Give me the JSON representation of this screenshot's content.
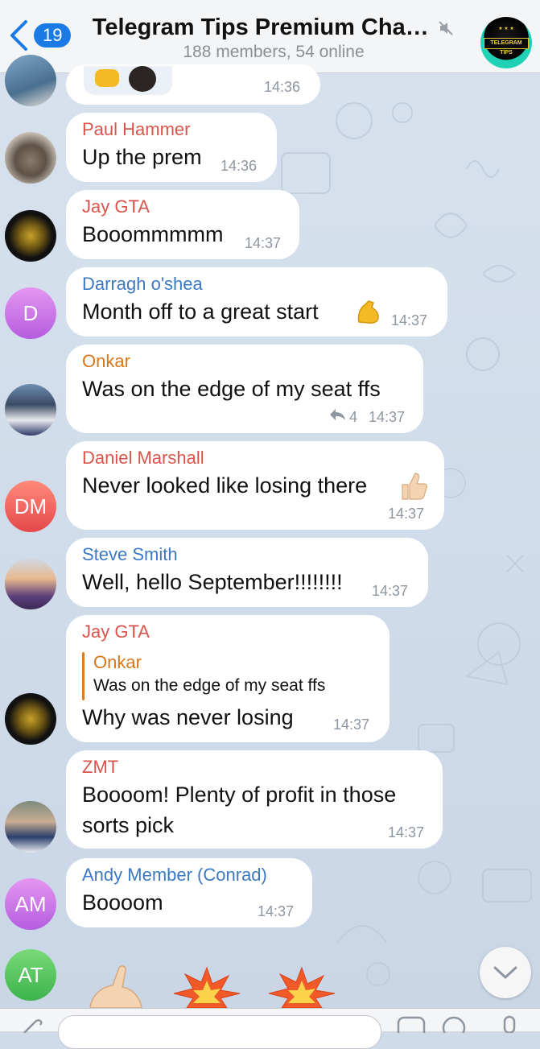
{
  "header": {
    "back_count": "19",
    "title": "Telegram Tips Premium Chat...",
    "subtitle": "188 members, 54 online",
    "group_avatar_text": "TELEGRAM TIPS"
  },
  "messages": [
    {
      "id": "m0",
      "time": "14:36"
    },
    {
      "id": "m1",
      "sender": "Paul Hammer",
      "text": "Up the prem",
      "time": "14:36"
    },
    {
      "id": "m2",
      "sender": "Jay GTA",
      "text": "Booommmmm",
      "time": "14:37"
    },
    {
      "id": "m3",
      "sender": "Darragh o'shea",
      "avatar_initials": "D",
      "text": "Month off to a great start",
      "time": "14:37"
    },
    {
      "id": "m4",
      "sender": "Onkar",
      "text": "Was on the edge of my seat ffs",
      "reply_count": "4",
      "time": "14:37"
    },
    {
      "id": "m5",
      "sender": "Daniel Marshall",
      "avatar_initials": "DM",
      "text": "Never looked like losing there",
      "time": "14:37"
    },
    {
      "id": "m6",
      "sender": "Steve Smith",
      "text": "Well, hello September!!!!!!!!",
      "time": "14:37"
    },
    {
      "id": "m7",
      "sender": "Jay GTA",
      "reply_to_name": "Onkar",
      "reply_to_text": "Was on the edge of my seat ffs",
      "text": "Why was never losing",
      "time": "14:37"
    },
    {
      "id": "m8",
      "sender": "ZMT",
      "text_line1": "Boooom! Plenty of profit in those",
      "text_line2": "sorts pick",
      "time": "14:37"
    },
    {
      "id": "m9",
      "sender": "Andy Member (Conrad)",
      "avatar_initials": "AM",
      "text": "Boooom",
      "time": "14:37"
    },
    {
      "id": "m10",
      "avatar_initials": "AT"
    }
  ],
  "colors": {
    "accent": "#1a7be7",
    "name_red": "#d9544a",
    "name_blue": "#3c79c2",
    "name_orange": "#d9761a"
  }
}
